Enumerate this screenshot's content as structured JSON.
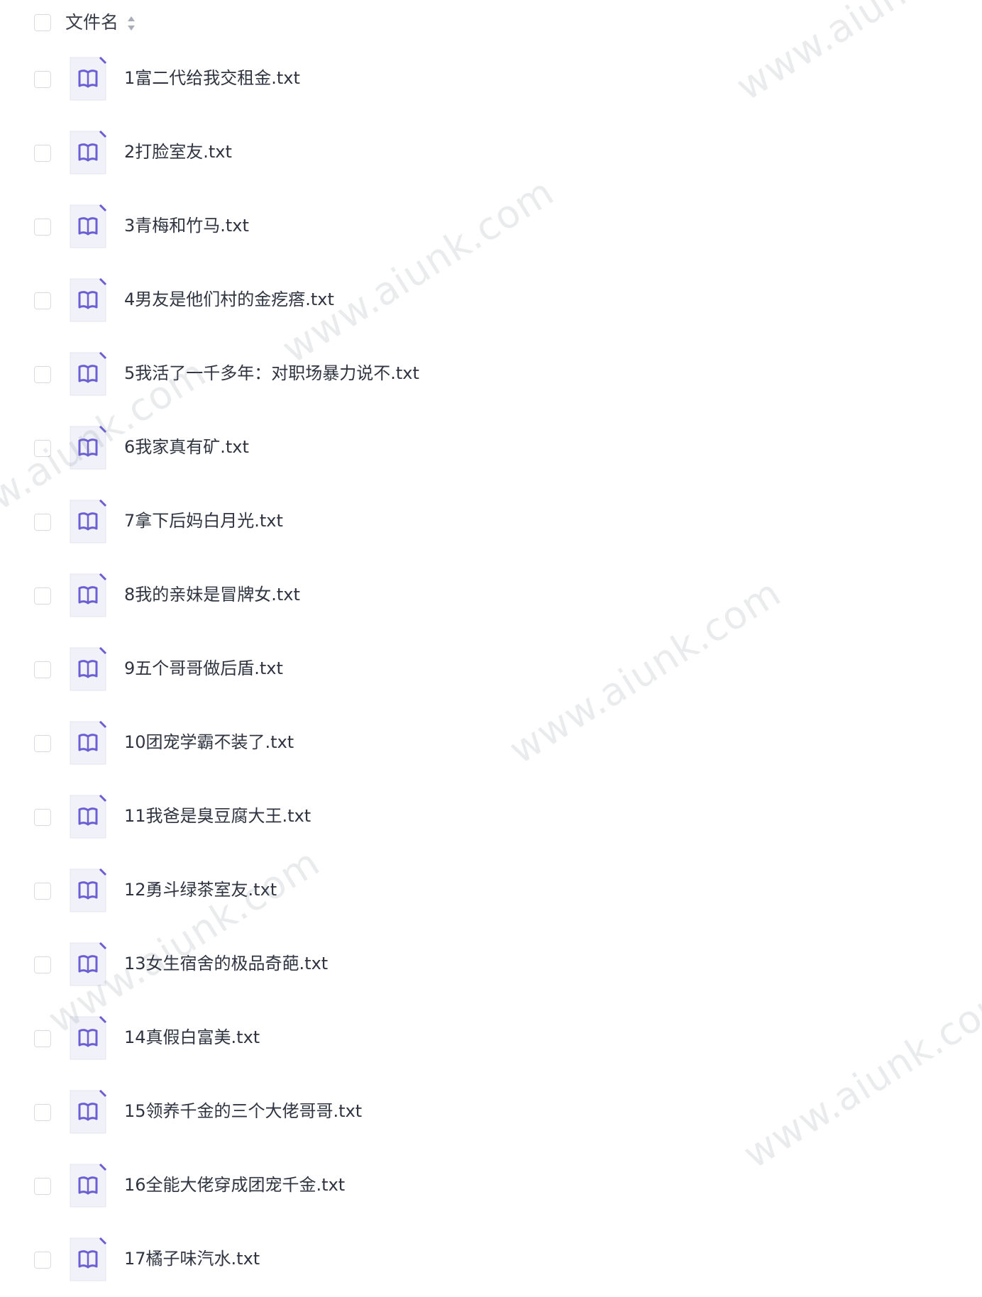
{
  "header": {
    "column_label": "文件名",
    "sort_icon": "sort-updown-icon"
  },
  "files": [
    {
      "name": "1富二代给我交租金.txt",
      "icon": "book-icon"
    },
    {
      "name": "2打脸室友.txt",
      "icon": "book-icon"
    },
    {
      "name": "3青梅和竹马.txt",
      "icon": "book-icon"
    },
    {
      "name": "4男友是他们村的金疙瘩.txt",
      "icon": "book-icon"
    },
    {
      "name": "5我活了一千多年：对职场暴力说不.txt",
      "icon": "book-icon"
    },
    {
      "name": "6我家真有矿.txt",
      "icon": "book-icon"
    },
    {
      "name": "7拿下后妈白月光.txt",
      "icon": "book-icon"
    },
    {
      "name": "8我的亲妹是冒牌女.txt",
      "icon": "book-icon"
    },
    {
      "name": "9五个哥哥做后盾.txt",
      "icon": "book-icon"
    },
    {
      "name": "10团宠学霸不装了.txt",
      "icon": "book-icon"
    },
    {
      "name": "11我爸是臭豆腐大王.txt",
      "icon": "book-icon"
    },
    {
      "name": "12勇斗绿茶室友.txt",
      "icon": "book-icon"
    },
    {
      "name": "13女生宿舍的极品奇葩.txt",
      "icon": "book-icon"
    },
    {
      "name": "14真假白富美.txt",
      "icon": "book-icon"
    },
    {
      "name": "15领养千金的三个大佬哥哥.txt",
      "icon": "book-icon"
    },
    {
      "name": "16全能大佬穿成团宠千金.txt",
      "icon": "book-icon"
    },
    {
      "name": "17橘子味汽水.txt",
      "icon": "book-icon"
    }
  ],
  "watermark": {
    "text": "www.aiunk.com"
  },
  "colors": {
    "icon_accent": "#6b5fd3",
    "icon_bg": "#f1f1f9",
    "checkbox_border": "#d9dbe1",
    "text": "#2f3440"
  }
}
